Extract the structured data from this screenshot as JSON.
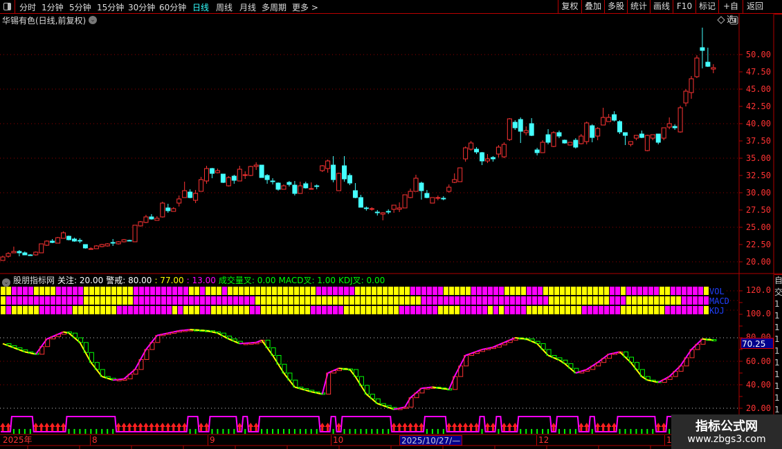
{
  "toolbar": {
    "timeframes": [
      "分时",
      "1分钟",
      "5分钟",
      "15分钟",
      "30分钟",
      "60分钟",
      "日线",
      "周线",
      "月线",
      "多周期",
      "更多 >"
    ],
    "active_timeframe": "日线",
    "buttons": [
      "复权",
      "叠加",
      "多股",
      "统计",
      "画线",
      "F10",
      "标记",
      "+自选",
      "返回"
    ]
  },
  "chart_title": "华锡有色(日线,前复权)",
  "colors": {
    "up": "#ff3333",
    "down": "#44ffff",
    "accent": "#33ffff",
    "grid": "#b00000",
    "magenta": "#ff00ff",
    "yellow": "#ffff00",
    "green": "#00ff00"
  },
  "price_axis": {
    "labels": [
      "50.00",
      "47.50",
      "45.00",
      "42.50",
      "40.00",
      "37.50",
      "35.00",
      "32.50",
      "30.00",
      "27.50",
      "25.00",
      "22.50",
      "20.00"
    ]
  },
  "indicator": {
    "name": "股朋指标网",
    "params": [
      {
        "text": "关注: 20.00",
        "color": "#ffffff"
      },
      {
        "text": "警戒: 80.00",
        "color": "#ffffff"
      },
      {
        "text": ": 77.00",
        "color": "#ffff00"
      },
      {
        "text": ": 13.00",
        "color": "#ff00ff"
      },
      {
        "text": "成交量叉: 0.00",
        "color": "#00ff00"
      },
      {
        "text": "MACD叉: 1.00",
        "color": "#00ff00"
      },
      {
        "text": "KDJ叉: 0.00",
        "color": "#00ff00"
      }
    ],
    "rows": [
      {
        "label": "VOL",
        "pattern": "YYMMMMYYYYMMMMMYYYYYYYYYMMMMMMMMMMYYMYYYMYYYYYYYYYYYYYYYYMMMMMMMYYYYYYYYYYMMMMMMYYYYYMMMMMMYYYYMMMYYYYYYYYYYYYMMYMMMMMMYYMMMMMMYYYY"
      },
      {
        "label": "MACD",
        "pattern": "YMMMMMMMMMMMMMMYYYYYYYYYMMMMMMMMMMMMMMMMMMMMMMYYYYYYYYYYYYYYYYYYYYYYYYYYYYYYMMMMMMMMMMMMMMMMMMMMMMMYYYYYYYYYYYMMMYYYYYYYYYYMMMMMYYY"
      },
      {
        "label": "KDJ",
        "pattern": "YMYYYYYMMMMMMYYYYYYYYMMMMMMMMMMYMYYYMMYYYYYYYMMYYYYYYYYYMMMMMMYYYYYYYYYYMMMMMMMYYYYMMMMMYMYMMMMYYYYYYYYYYMMMMMMMYYYYYYYYMMMMMMMYYYY"
      }
    ],
    "axis_labels": [
      "120.0",
      "100.0",
      "80.00",
      "60.00",
      "40.00",
      "20.00"
    ],
    "cursor_value": "70.25",
    "signal": "LLHHHHLLLLLLHHHHHHHHHLLLLLLLLLLLLLHHLLHHHHHLHLLHHHHHHHHHHHLLHLHHHHHHHHHLLLLLLHHHHLLLLLLHLLHLLLHHHHHHLHHHHLLHLLLLHHHHHHHLLHHHHHHHHHH"
  },
  "chart_data": {
    "type": "candlestick",
    "ohlc": [
      [
        20.2,
        20.9,
        20.2,
        20.7
      ],
      [
        20.8,
        21.4,
        20.6,
        21.2
      ],
      [
        21.3,
        22.2,
        21.3,
        21.5
      ],
      [
        21.5,
        21.7,
        20.8,
        21.3
      ],
      [
        21.3,
        21.5,
        21.0,
        21.0
      ],
      [
        21.0,
        21.1,
        20.9,
        20.9
      ],
      [
        21.0,
        21.5,
        20.9,
        21.4
      ],
      [
        21.3,
        22.6,
        21.3,
        22.6
      ],
      [
        22.4,
        23.1,
        22.3,
        23.0
      ],
      [
        23.0,
        23.3,
        22.7,
        22.8
      ],
      [
        22.7,
        23.6,
        22.7,
        23.5
      ],
      [
        23.4,
        24.4,
        23.4,
        24.2
      ],
      [
        23.7,
        23.8,
        23.1,
        23.2
      ],
      [
        23.3,
        23.5,
        22.9,
        23.0
      ],
      [
        23.1,
        23.4,
        22.7,
        23.1
      ],
      [
        22.5,
        22.5,
        21.9,
        22.0
      ],
      [
        21.8,
        22.1,
        21.8,
        21.9
      ],
      [
        21.9,
        22.4,
        21.9,
        22.3
      ],
      [
        22.2,
        22.6,
        22.1,
        22.5
      ],
      [
        22.3,
        22.7,
        22.2,
        22.6
      ],
      [
        22.8,
        23.3,
        22.3,
        22.8
      ],
      [
        22.6,
        23.0,
        22.5,
        22.9
      ],
      [
        22.9,
        23.3,
        22.8,
        23.2
      ],
      [
        23.1,
        23.2,
        23.0,
        23.1
      ],
      [
        22.9,
        25.3,
        22.9,
        25.3
      ],
      [
        25.2,
        25.9,
        25.1,
        25.8
      ],
      [
        25.7,
        26.8,
        25.6,
        26.5
      ],
      [
        26.5,
        26.9,
        26.1,
        26.2
      ],
      [
        26.0,
        26.6,
        26.0,
        26.3
      ],
      [
        26.5,
        28.7,
        26.4,
        28.5
      ],
      [
        27.8,
        28.4,
        27.1,
        27.4
      ],
      [
        27.3,
        27.9,
        27.3,
        27.7
      ],
      [
        28.5,
        29.6,
        28.0,
        29.1
      ],
      [
        29.3,
        31.6,
        29.3,
        30.3
      ],
      [
        30.1,
        30.5,
        29.2,
        29.3
      ],
      [
        28.9,
        30.4,
        28.5,
        29.9
      ],
      [
        30.2,
        32.3,
        30.2,
        31.9
      ],
      [
        31.7,
        33.9,
        31.3,
        33.5
      ],
      [
        33.5,
        33.6,
        32.1,
        32.8
      ],
      [
        32.9,
        33.5,
        32.8,
        33.2
      ],
      [
        32.7,
        32.7,
        31.4,
        31.5
      ],
      [
        31.0,
        32.4,
        30.9,
        32.2
      ],
      [
        32.4,
        32.6,
        31.3,
        31.8
      ],
      [
        31.7,
        33.9,
        31.7,
        33.4
      ],
      [
        32.5,
        33.1,
        32.0,
        32.6
      ],
      [
        32.5,
        33.9,
        32.4,
        33.8
      ],
      [
        33.8,
        34.4,
        33.3,
        34.0
      ],
      [
        34.0,
        34.0,
        32.2,
        32.2
      ],
      [
        32.5,
        32.7,
        31.3,
        31.9
      ],
      [
        31.7,
        32.1,
        31.2,
        31.7
      ],
      [
        31.4,
        31.5,
        30.3,
        30.5
      ],
      [
        30.5,
        31.2,
        30.5,
        31.0
      ],
      [
        31.5,
        31.7,
        30.9,
        31.2
      ],
      [
        31.1,
        31.7,
        29.6,
        29.9
      ],
      [
        29.9,
        31.6,
        29.9,
        31.0
      ],
      [
        31.3,
        31.6,
        30.6,
        30.7
      ],
      [
        30.5,
        31.5,
        30.5,
        30.6
      ],
      [
        31.0,
        31.2,
        30.5,
        31.0
      ],
      [
        33.2,
        34.0,
        33.0,
        33.9
      ],
      [
        33.5,
        34.8,
        32.9,
        34.6
      ],
      [
        34.0,
        35.3,
        31.5,
        31.9
      ],
      [
        30.3,
        32.9,
        30.3,
        32.8
      ],
      [
        33.9,
        35.3,
        31.6,
        32.0
      ],
      [
        32.5,
        32.8,
        31.1,
        31.4
      ],
      [
        30.3,
        31.4,
        29.2,
        29.3
      ],
      [
        29.3,
        29.7,
        27.9,
        27.9
      ],
      [
        27.8,
        28.0,
        27.4,
        27.7
      ],
      [
        27.6,
        27.9,
        27.4,
        27.7
      ],
      [
        27.2,
        27.5,
        26.7,
        27.1
      ],
      [
        26.9,
        27.2,
        26.0,
        27.1
      ],
      [
        27.3,
        27.6,
        26.9,
        27.3
      ],
      [
        27.6,
        28.2,
        27.1,
        28.2
      ],
      [
        27.6,
        28.6,
        27.2,
        27.8
      ],
      [
        27.8,
        29.7,
        27.8,
        29.7
      ],
      [
        29.3,
        30.6,
        29.2,
        30.2
      ],
      [
        30.2,
        32.6,
        30.2,
        32.1
      ],
      [
        31.4,
        31.6,
        29.0,
        30.3
      ],
      [
        29.9,
        30.4,
        29.2,
        29.3
      ],
      [
        28.5,
        29.3,
        28.5,
        29.3
      ],
      [
        29.2,
        29.6,
        28.9,
        29.3
      ],
      [
        29.2,
        29.5,
        28.9,
        29.2
      ],
      [
        30.2,
        31.2,
        30.0,
        30.8
      ],
      [
        31.5,
        32.8,
        31.4,
        31.9
      ],
      [
        31.6,
        33.6,
        31.6,
        33.6
      ],
      [
        34.9,
        36.7,
        34.5,
        36.5
      ],
      [
        36.3,
        37.5,
        36.1,
        37.2
      ],
      [
        36.3,
        36.6,
        35.6,
        35.9
      ],
      [
        35.8,
        35.9,
        34.0,
        34.6
      ],
      [
        34.6,
        35.6,
        34.3,
        34.9
      ],
      [
        35.1,
        35.3,
        34.5,
        34.9
      ],
      [
        35.6,
        36.9,
        35.1,
        36.6
      ],
      [
        35.2,
        37.3,
        35.0,
        37.0
      ],
      [
        37.7,
        40.8,
        37.5,
        40.7
      ],
      [
        40.2,
        40.5,
        39.1,
        39.4
      ],
      [
        40.6,
        40.9,
        37.2,
        38.9
      ],
      [
        38.7,
        39.6,
        38.3,
        39.0
      ],
      [
        40.0,
        40.8,
        38.2,
        38.3
      ],
      [
        36.2,
        36.5,
        35.4,
        35.8
      ],
      [
        35.8,
        37.6,
        35.8,
        37.3
      ],
      [
        38.4,
        39.2,
        37.0,
        37.3
      ],
      [
        36.7,
        38.9,
        36.6,
        38.7
      ],
      [
        38.7,
        39.0,
        37.9,
        38.2
      ],
      [
        37.6,
        37.7,
        37.1,
        37.2
      ],
      [
        36.9,
        37.3,
        36.9,
        37.3
      ],
      [
        37.6,
        37.9,
        36.4,
        36.6
      ],
      [
        37.1,
        38.5,
        37.0,
        38.2
      ],
      [
        37.4,
        40.3,
        37.0,
        40.1
      ],
      [
        39.7,
        39.9,
        37.3,
        38.0
      ],
      [
        38.2,
        39.5,
        37.6,
        39.3
      ],
      [
        39.8,
        42.3,
        39.8,
        40.9
      ],
      [
        40.3,
        41.4,
        40.3,
        40.9
      ],
      [
        41.3,
        41.8,
        40.3,
        40.5
      ],
      [
        40.3,
        40.5,
        38.5,
        38.8
      ],
      [
        38.7,
        38.7,
        36.9,
        38.3
      ],
      [
        37.0,
        37.4,
        36.7,
        37.4
      ],
      [
        37.9,
        38.3,
        37.6,
        38.3
      ],
      [
        38.5,
        39.0,
        37.9,
        38.0
      ],
      [
        36.1,
        38.4,
        36.0,
        38.3
      ],
      [
        37.9,
        38.4,
        37.6,
        38.4
      ],
      [
        38.5,
        38.5,
        37.0,
        37.3
      ],
      [
        37.9,
        39.4,
        37.6,
        39.4
      ],
      [
        39.5,
        40.9,
        39.2,
        40.0
      ],
      [
        39.6,
        39.9,
        39.1,
        39.4
      ],
      [
        38.8,
        42.6,
        38.7,
        42.3
      ],
      [
        43.0,
        45.0,
        42.5,
        44.7
      ],
      [
        44.5,
        46.9,
        43.6,
        46.5
      ],
      [
        46.8,
        49.9,
        46.6,
        49.5
      ],
      [
        51.0,
        53.9,
        48.0,
        50.6
      ],
      [
        48.9,
        51.0,
        48.2,
        48.3
      ],
      [
        47.9,
        48.6,
        47.3,
        48.1
      ]
    ],
    "ylim": [
      20,
      50
    ],
    "oscillator_points": [
      [
        0,
        75
      ],
      [
        4,
        68
      ],
      [
        6,
        66
      ],
      [
        8,
        79
      ],
      [
        11,
        85
      ],
      [
        12,
        84
      ],
      [
        14,
        76
      ],
      [
        16,
        59
      ],
      [
        18,
        47
      ],
      [
        20,
        44
      ],
      [
        22,
        45
      ],
      [
        24,
        53
      ],
      [
        26,
        70
      ],
      [
        28,
        82
      ],
      [
        32,
        86
      ],
      [
        34,
        87
      ],
      [
        37,
        86
      ],
      [
        39,
        84
      ],
      [
        41,
        79
      ],
      [
        43,
        75
      ],
      [
        46,
        76
      ],
      [
        47,
        78
      ],
      [
        49,
        65
      ],
      [
        51,
        50
      ],
      [
        53,
        38
      ],
      [
        56,
        34
      ],
      [
        58,
        32
      ],
      [
        59,
        50
      ],
      [
        61,
        54
      ],
      [
        63,
        53
      ],
      [
        64,
        47
      ],
      [
        66,
        32
      ],
      [
        68,
        24
      ],
      [
        71,
        19
      ],
      [
        73,
        21
      ],
      [
        74,
        29
      ],
      [
        76,
        37
      ],
      [
        78,
        38
      ],
      [
        81,
        36
      ],
      [
        82,
        47
      ],
      [
        84,
        65
      ],
      [
        87,
        70
      ],
      [
        89,
        72
      ],
      [
        91,
        76
      ],
      [
        93,
        80
      ],
      [
        95,
        79
      ],
      [
        97,
        75
      ],
      [
        99,
        65
      ],
      [
        101,
        61
      ],
      [
        102,
        58
      ],
      [
        104,
        50
      ],
      [
        106,
        53
      ],
      [
        108,
        59
      ],
      [
        110,
        66
      ],
      [
        112,
        68
      ],
      [
        114,
        59
      ],
      [
        116,
        47
      ],
      [
        117,
        44
      ],
      [
        119,
        42
      ],
      [
        121,
        47
      ],
      [
        123,
        56
      ],
      [
        125,
        70
      ],
      [
        127,
        79
      ],
      [
        129,
        78
      ],
      [
        130,
        77
      ]
    ],
    "oscillator_ylim": [
      20,
      120
    ],
    "grid": true
  },
  "date_axis": {
    "labels": [
      {
        "text": "2025年",
        "pos": "start"
      },
      {
        "text": "8"
      },
      {
        "text": "9"
      },
      {
        "text": "10"
      },
      {
        "text": "12"
      },
      {
        "text": "1"
      }
    ],
    "selected_date": "2025/10/27/—"
  },
  "right_strip": [
    "自",
    "交",
    "1",
    "1",
    "1",
    "1",
    "1",
    "1",
    "1",
    "1",
    "1",
    "1",
    "1"
  ],
  "watermark": {
    "title": "指标公式网",
    "url": "www.zbgs3.com"
  }
}
